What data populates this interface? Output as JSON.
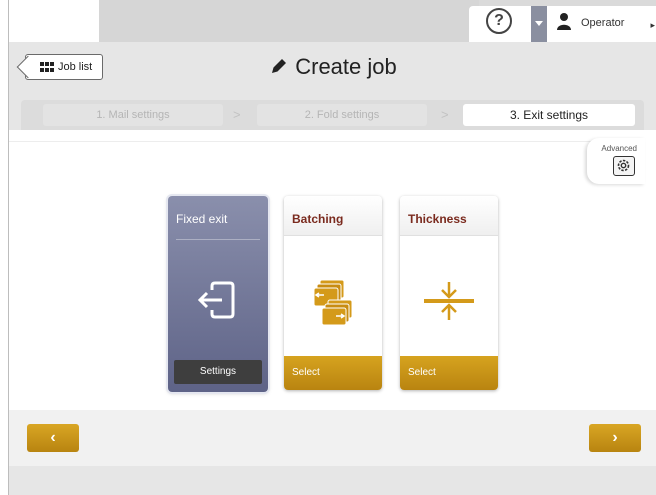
{
  "topbar": {
    "help_icon": "question-circle-icon",
    "help_glyph": "?",
    "dropdown_icon": "caret-down-icon",
    "user_icon": "person-icon",
    "user_label": "Operator",
    "user_menu_icon": "caret-right-icon"
  },
  "header": {
    "back_button_label": "Job list",
    "back_button_icon": "grid-icon",
    "title": "Create job",
    "title_icon": "pencil-icon"
  },
  "steps": [
    {
      "label": "1. Mail settings",
      "state": "inactive"
    },
    {
      "label": "2. Fold settings",
      "state": "inactive"
    },
    {
      "label": "3. Exit settings",
      "state": "active"
    }
  ],
  "step_separator": ">",
  "advanced": {
    "label": "Advanced",
    "icon": "gear-icon"
  },
  "cards": [
    {
      "title": "Fixed exit",
      "icon": "exit-arrow-icon",
      "button": "Settings",
      "selected": true
    },
    {
      "title": "Batching",
      "icon": "batching-stack-icon",
      "button": "Select",
      "selected": false
    },
    {
      "title": "Thickness",
      "icon": "thickness-arrows-icon",
      "button": "Select",
      "selected": false
    }
  ],
  "footer": {
    "prev_glyph": "‹",
    "next_glyph": "›"
  },
  "colors": {
    "accent_gold": "#c8951a",
    "selected_card": "#6f7498",
    "card_title": "#7a2a1e",
    "user_dropdown": "#8a8fa0"
  }
}
